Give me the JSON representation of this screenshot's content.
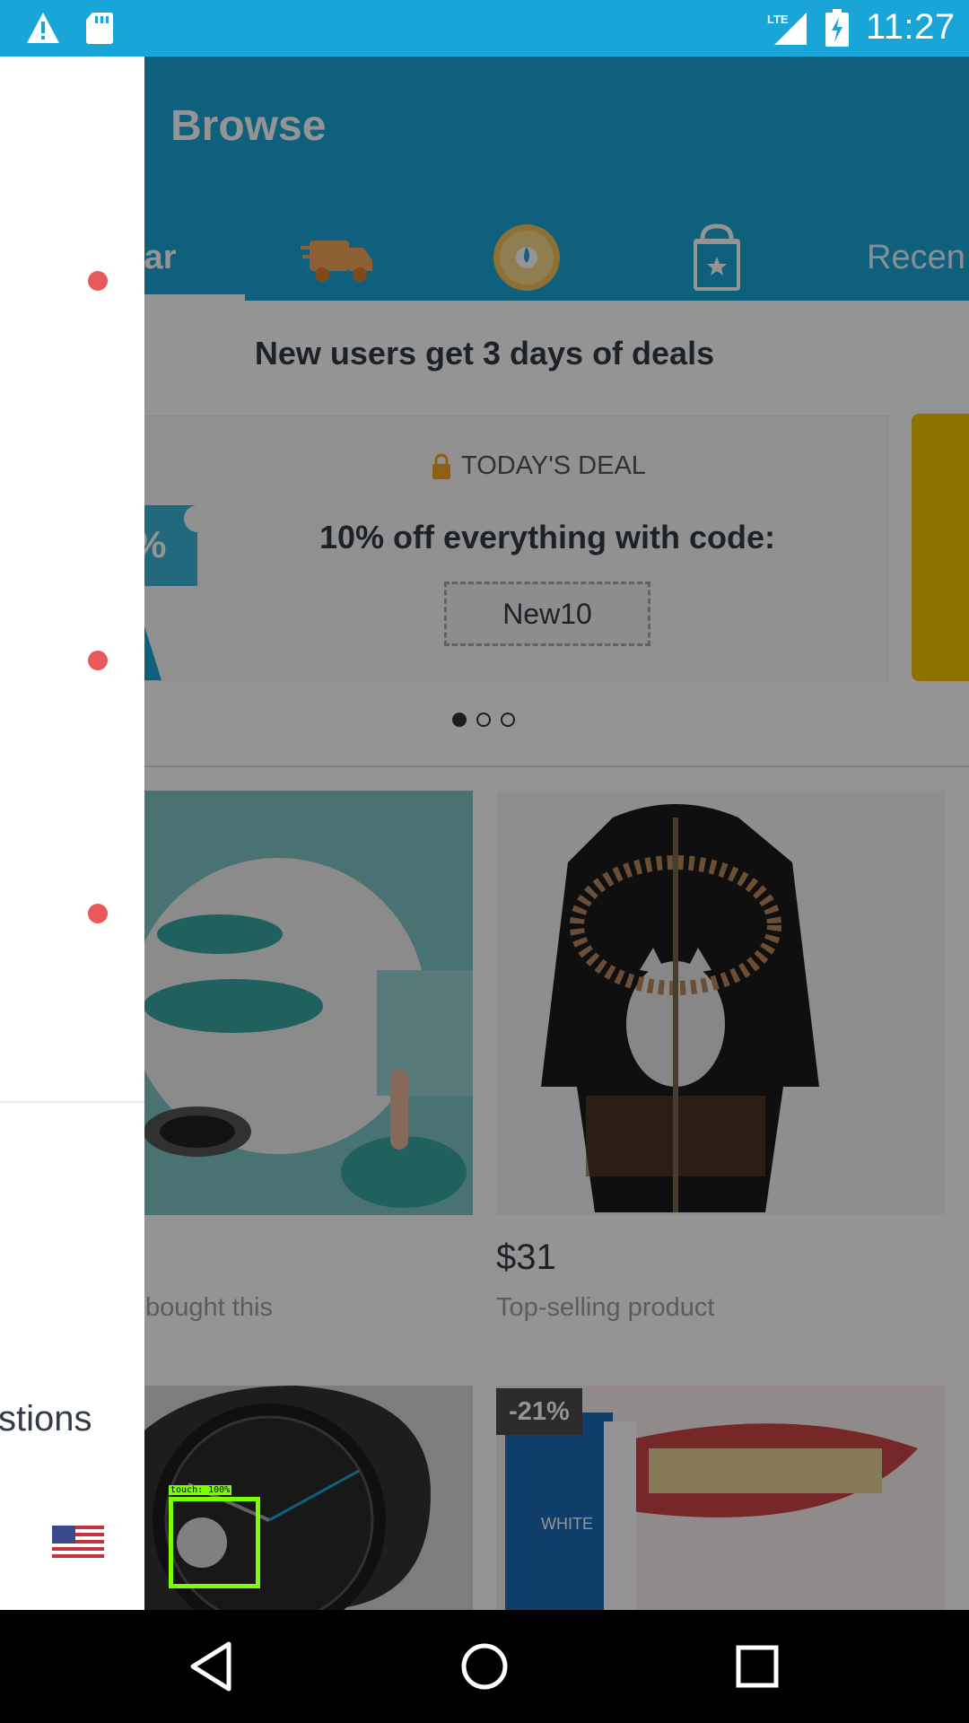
{
  "status_bar": {
    "time": "11:27",
    "network": "LTE",
    "icons": [
      "warning-icon",
      "sd-card-icon",
      "lte-signal-icon",
      "battery-charging-icon"
    ]
  },
  "header": {
    "title": "Browse",
    "tabs": [
      {
        "label": "lar",
        "type": "text",
        "selected": true
      },
      {
        "label": "",
        "icon": "fast-shipping-truck-icon",
        "type": "icon"
      },
      {
        "label": "",
        "icon": "wheel-icon",
        "type": "icon"
      },
      {
        "label": "",
        "icon": "shopping-bag-star-icon",
        "type": "icon"
      },
      {
        "label": "Recen",
        "type": "text",
        "selected": false
      }
    ]
  },
  "promo": {
    "banner_text": "New users get 3 days of deals",
    "deal_tag": "TODAY'S DEAL",
    "deal_title": "10% off everything with code:",
    "deal_code": "New10",
    "carousel_pages": 3,
    "carousel_active": 0
  },
  "products": [
    {
      "name": "drain-stopper",
      "price": "",
      "subtext": "bought this"
    },
    {
      "name": "wolf-hoodie",
      "price": "$31",
      "subtext": "Top-selling product"
    },
    {
      "name": "watch",
      "price": "",
      "subtext": ""
    },
    {
      "name": "teeth-whitening-pen",
      "badge": "-21%"
    }
  ],
  "drawer": {
    "notification_dots": 3,
    "questions_label": "stions",
    "flag": "us-flag-icon"
  },
  "touch_overlay": {
    "label": "touch: 100%"
  },
  "colors": {
    "brand_blue": "#1aa5d8",
    "notification_red": "#e9585a",
    "deal_yellow": "#f5c400"
  },
  "nav_bar": {
    "buttons": [
      "back-icon",
      "home-icon",
      "recents-icon"
    ]
  }
}
